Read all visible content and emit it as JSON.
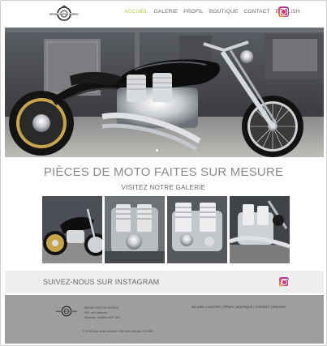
{
  "header": {
    "logo_text": "BRUNO MOTOR WORKS",
    "nav": [
      {
        "label": "ACCUEIL",
        "active": true
      },
      {
        "label": "GALERIE",
        "active": false
      },
      {
        "label": "PROFIL",
        "active": false
      },
      {
        "label": "BOUTIQUE",
        "active": false
      },
      {
        "label": "CONTACT",
        "active": false
      },
      {
        "label": "ENGLISH",
        "active": false
      }
    ],
    "instagram_icon": "instagram-icon"
  },
  "hero": {
    "slide_count": 3,
    "active_slide": 1
  },
  "main": {
    "title": "PIÈCES DE MOTO FAITES SUR MESURE",
    "gallery_link": "VISITEZ NOTRE GALERIE",
    "gallery_count": 4
  },
  "instagram": {
    "label": "SUIVEZ-NOUS SUR INSTAGRAM",
    "icon": "instagram-icon"
  },
  "footer": {
    "logo_text": "BRUNO MOTOR WORKS",
    "address_line1": "BRUNO MOTOR WORKS",
    "address_line2": "INC. rue Lafleuris,",
    "address_line3": "Montréal, Québec H1P 3B0",
    "nav": "ACCUEIL | GALERIE | PROFIL | BOUTIQUE | CONTACT | ENGLISH",
    "copyright": "© 2016 Tous droits réservés • Site web créé par VOD INC."
  },
  "colors": {
    "accent": "#b6c93a",
    "footer_bg": "#9e9e9e",
    "band_bg": "#eeeeee"
  }
}
